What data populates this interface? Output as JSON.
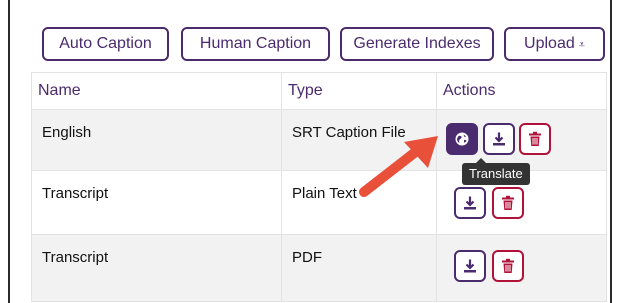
{
  "toolbar": {
    "auto_caption": "Auto Caption",
    "human_caption": "Human Caption",
    "generate_indexes": "Generate Indexes",
    "upload": "Upload",
    "upload_icon": "upload-caret-icon"
  },
  "table": {
    "headers": {
      "name": "Name",
      "type": "Type",
      "actions": "Actions"
    },
    "rows": [
      {
        "name": "English",
        "type": "SRT Caption File",
        "actions": [
          "translate",
          "download",
          "delete"
        ]
      },
      {
        "name": "Transcript",
        "type": "Plain Text",
        "actions": [
          "download",
          "delete"
        ]
      },
      {
        "name": "Transcript",
        "type": "PDF",
        "actions": [
          "download",
          "delete"
        ]
      }
    ]
  },
  "tooltip": {
    "text": "Translate"
  },
  "colors": {
    "brand_purple": "#4a2b6e",
    "delete_red": "#b0123a",
    "annotation_arrow": "#e8503a",
    "row_stripe": "#f2f2f2"
  },
  "icons": {
    "translate": "globe-icon",
    "download": "download-icon",
    "delete": "trash-icon"
  }
}
